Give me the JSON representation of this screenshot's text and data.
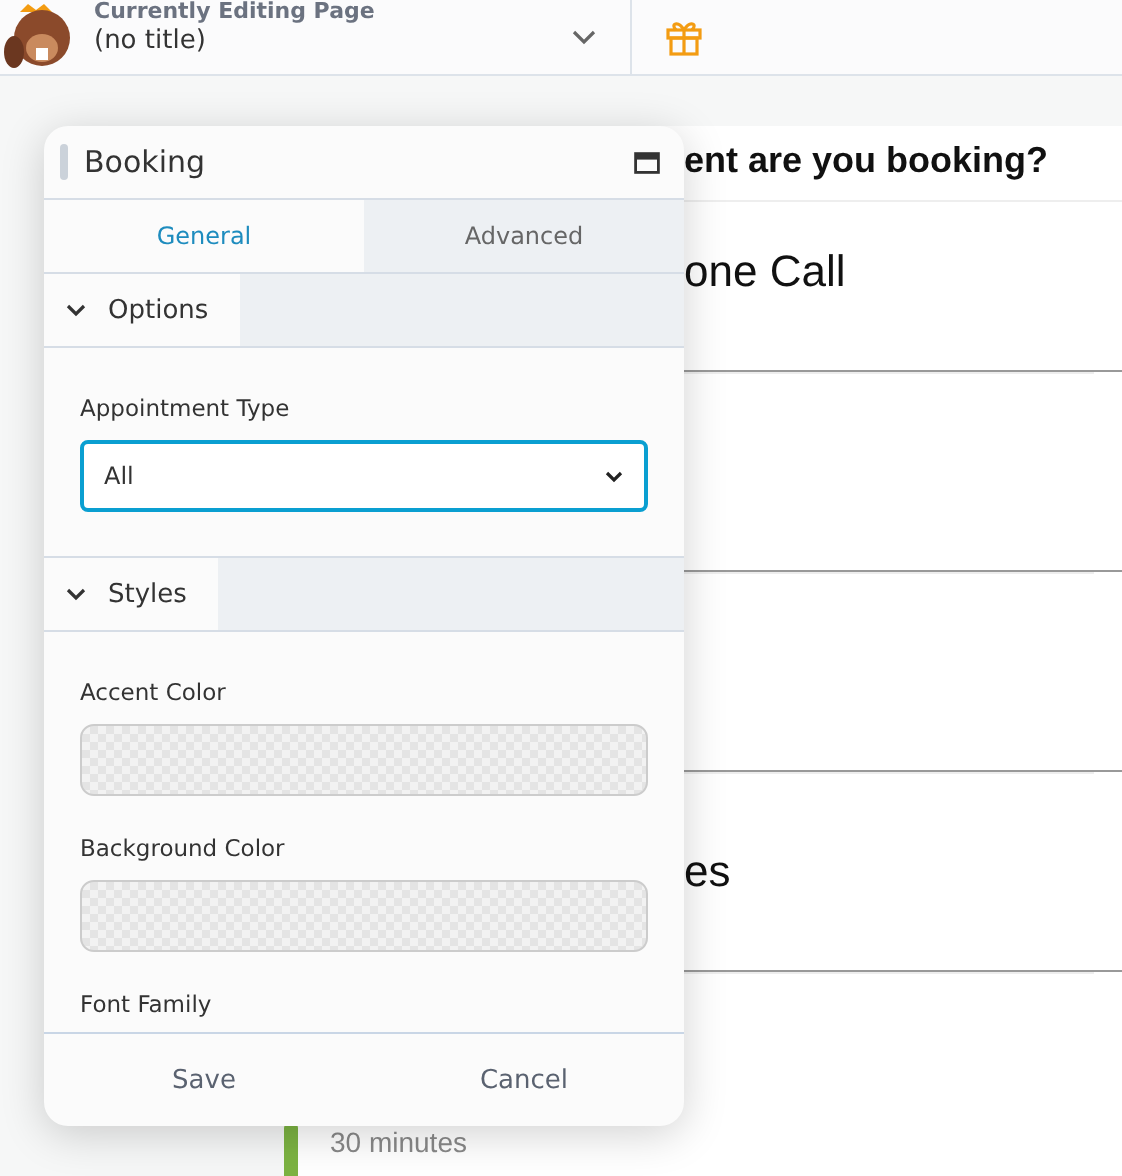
{
  "header": {
    "caption": "Currently Editing Page",
    "page_title": "(no title)"
  },
  "content": {
    "heading": "ent are you booking?",
    "options": [
      {
        "kind": "titled",
        "title": "one Call"
      },
      {
        "kind": "blank"
      },
      {
        "kind": "blank"
      },
      {
        "kind": "titled",
        "title": "es"
      }
    ],
    "next_item": {
      "duration": "30 minutes"
    }
  },
  "panel": {
    "title": "Booking",
    "tabs": [
      {
        "label": "General",
        "selected": true
      },
      {
        "label": "Advanced",
        "selected": false
      }
    ],
    "sections": [
      {
        "title": "Options",
        "expanded": true,
        "fields": [
          {
            "kind": "select",
            "label": "Appointment Type",
            "value": "All"
          }
        ]
      },
      {
        "title": "Styles",
        "expanded": true,
        "fields": [
          {
            "kind": "color",
            "label": "Accent Color"
          },
          {
            "kind": "color",
            "label": "Background Color"
          },
          {
            "kind": "heading",
            "label": "Font Family"
          }
        ]
      }
    ],
    "buttons": [
      "Save",
      "Cancel"
    ]
  }
}
